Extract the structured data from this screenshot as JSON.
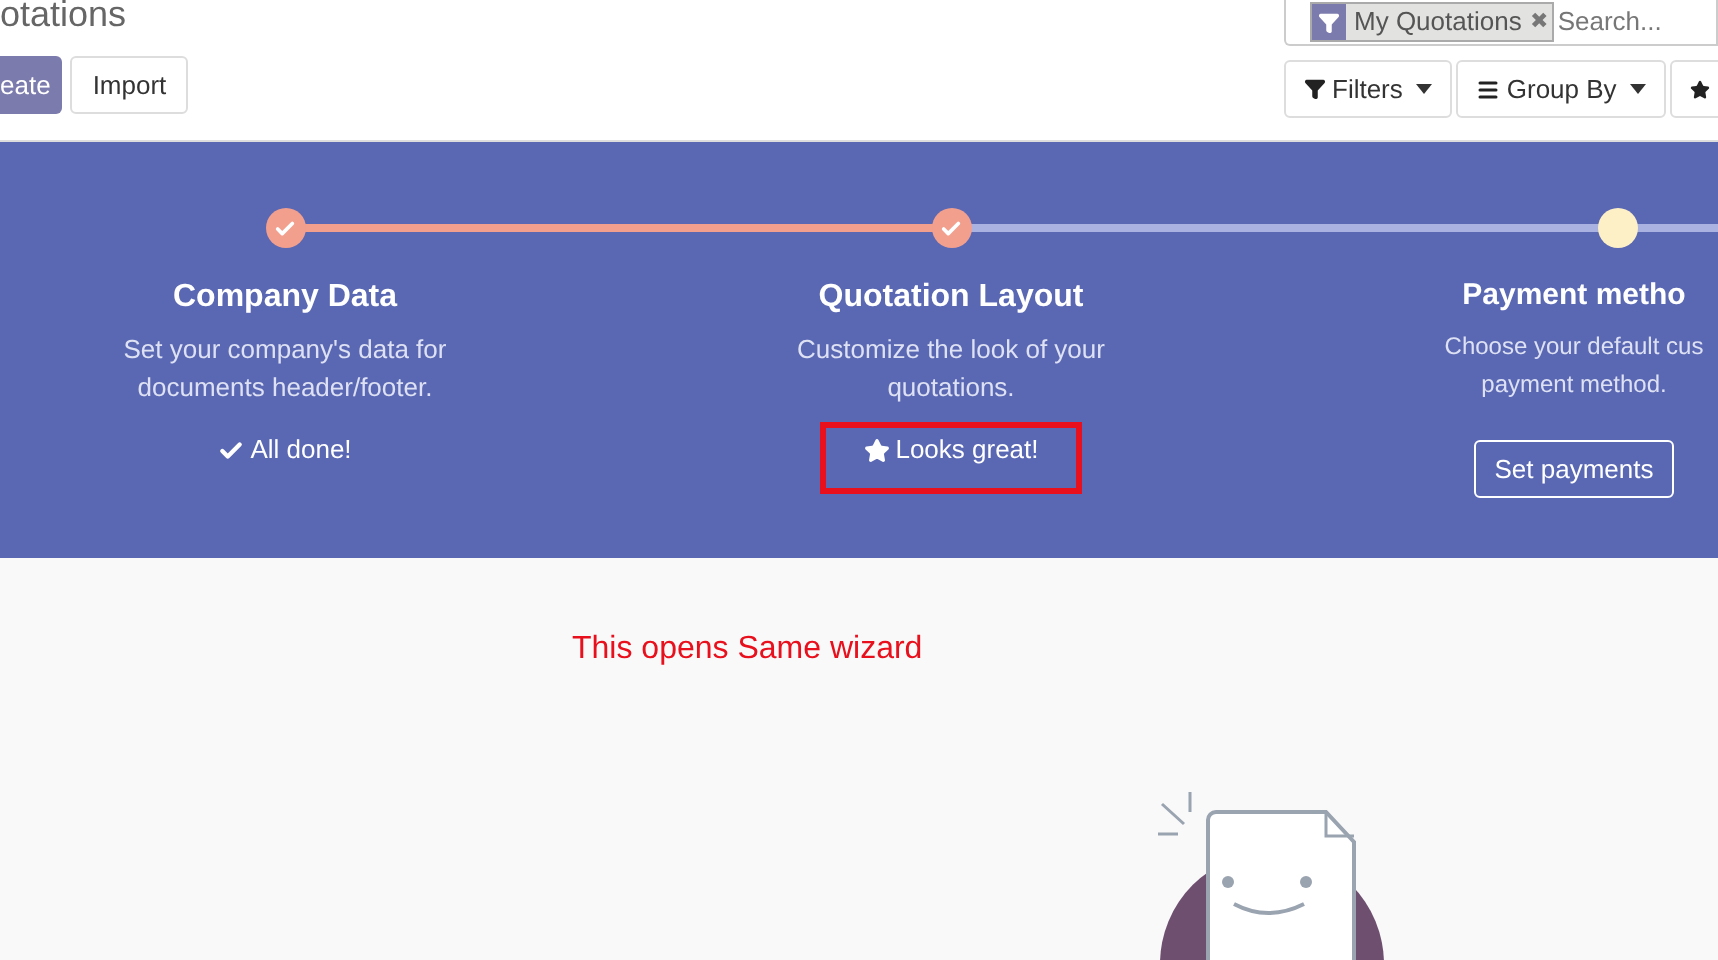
{
  "header": {
    "title": "otations",
    "buttons": [
      {
        "label": "eate",
        "kind": "primary"
      },
      {
        "label": "Import",
        "kind": "secondary"
      }
    ]
  },
  "search": {
    "facet": "My Quotations",
    "facet_close": "✖",
    "placeholder": "Search..."
  },
  "search_buttons": [
    {
      "label": "Filters",
      "kind": "filter"
    },
    {
      "label": "Group By",
      "kind": "group"
    },
    {
      "kind": "favorite"
    }
  ],
  "steps": [
    {
      "title": "Company Data",
      "description": "Set your company's data for documents header/footer.",
      "done": true,
      "kind": "status",
      "action": "All done!",
      "highlighted": false
    },
    {
      "title": "Quotation Layout",
      "description": "Customize the look of your quotations.",
      "done": true,
      "kind": "status",
      "action": "Looks great!",
      "highlighted": true
    },
    {
      "title": "Payment metho",
      "description": "Choose your default cus payment method.",
      "done": false,
      "kind": "button",
      "action": "Set payments",
      "highlighted": false
    }
  ],
  "annotation": "This opens Same wizard"
}
